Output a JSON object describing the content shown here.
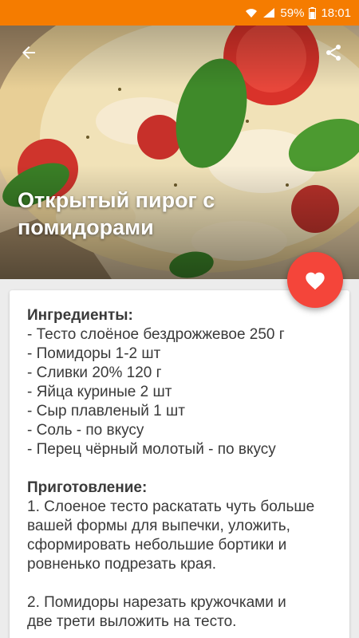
{
  "status": {
    "battery": "59%",
    "time": "18:01"
  },
  "recipe": {
    "title": "Открытый пирог с помидорами",
    "ingredients_title": "Ингредиенты:",
    "ingredients": [
      "- Тесто слоёное бездрожжевое 250 г",
      "- Помидоры 1-2 шт",
      "- Сливки 20% 120 г",
      "- Яйца куриные 2 шт",
      "- Сыр плавленый 1 шт",
      "- Соль - по вкусу",
      "- Перец чёрный молотый - по вкусу"
    ],
    "steps_title": "Приготовление:",
    "steps": [
      [
        "1. Слоеное тесто раскатать чуть больше",
        "вашей формы для выпечки, уложить,",
        "сформировать небольшие бортики и",
        "ровненько подрезать края."
      ],
      [
        "2. Помидоры нарезать кружочками и",
        "две трети выложить на тесто."
      ]
    ]
  },
  "colors": {
    "status_bar": "#f57c00",
    "fab": "#f4453a"
  },
  "icons": {
    "back": "arrow-left-icon",
    "share": "share-icon",
    "favorite": "heart-icon"
  }
}
